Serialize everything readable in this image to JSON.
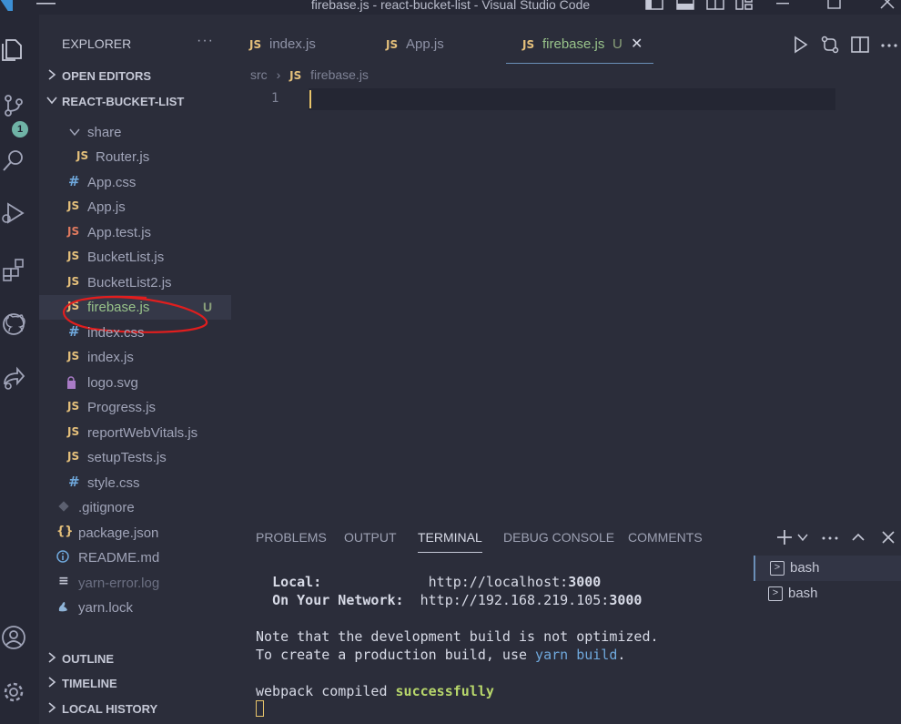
{
  "window": {
    "title": "firebase.js - react-bucket-list - Visual Studio Code"
  },
  "activity_bar": {
    "source_control_badge": "1",
    "items": [
      "explorer",
      "source-control",
      "search",
      "run-debug",
      "extensions",
      "github",
      "remote",
      "accounts",
      "settings"
    ]
  },
  "sidebar": {
    "title": "EXPLORER",
    "more": "···",
    "sections": {
      "open_editors": "OPEN EDITORS",
      "project": "REACT-BUCKET-LIST",
      "outline": "OUTLINE",
      "timeline": "TIMELINE",
      "local_history": "LOCAL HISTORY"
    },
    "tree": [
      {
        "name": "share",
        "type": "folder"
      },
      {
        "name": "Router.js",
        "icon": "JS"
      },
      {
        "name": "App.css",
        "icon": "#"
      },
      {
        "name": "App.js",
        "icon": "JS"
      },
      {
        "name": "App.test.js",
        "icon": "JS"
      },
      {
        "name": "BucketList.js",
        "icon": "JS"
      },
      {
        "name": "BucketList2.js",
        "icon": "JS"
      },
      {
        "name": "firebase.js",
        "icon": "JS",
        "status": "U"
      },
      {
        "name": "index.css",
        "icon": "#"
      },
      {
        "name": "index.js",
        "icon": "JS"
      },
      {
        "name": "logo.svg",
        "icon": "svg"
      },
      {
        "name": "Progress.js",
        "icon": "JS"
      },
      {
        "name": "reportWebVitals.js",
        "icon": "JS"
      },
      {
        "name": "setupTests.js",
        "icon": "JS"
      },
      {
        "name": "style.css",
        "icon": "#"
      },
      {
        "name": ".gitignore",
        "icon": "git"
      },
      {
        "name": "package.json",
        "icon": "{}"
      },
      {
        "name": "README.md",
        "icon": "i"
      },
      {
        "name": "yarn-error.log",
        "icon": "≡"
      },
      {
        "name": "yarn.lock",
        "icon": "yarn"
      }
    ]
  },
  "editor": {
    "tabs": [
      {
        "name": "index.js",
        "icon": "JS"
      },
      {
        "name": "App.js",
        "icon": "JS"
      },
      {
        "name": "firebase.js",
        "icon": "JS",
        "status": "U",
        "close": "✕"
      }
    ],
    "breadcrumb": {
      "folder": "src",
      "file": "firebase.js",
      "icon": "JS"
    },
    "line_number": "1"
  },
  "panel": {
    "tabs": [
      "PROBLEMS",
      "OUTPUT",
      "TERMINAL",
      "DEBUG CONSOLE",
      "COMMENTS"
    ],
    "active_tab": "TERMINAL",
    "terminal": {
      "local_label": "Local:",
      "local_url_prefix": "http://localhost:",
      "local_port": "3000",
      "network_label": "On Your Network:",
      "network_url_prefix": "http://192.168.219.105:",
      "network_port": "3000",
      "note_line": "Note that the development build is not optimized.",
      "prod_prefix": "To create a production build, use ",
      "prod_cmd": "yarn build",
      "prod_suffix": ".",
      "compiled_prefix": "webpack compiled ",
      "compiled_status": "successfully"
    },
    "terminal_list": [
      "bash",
      "bash"
    ]
  }
}
